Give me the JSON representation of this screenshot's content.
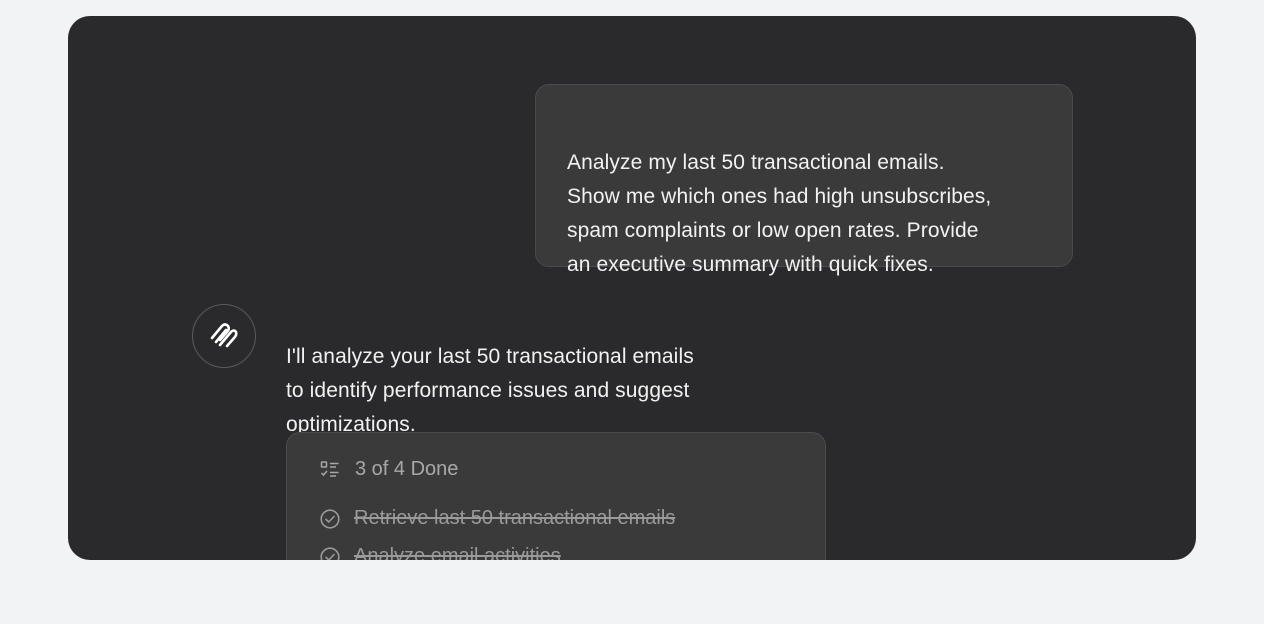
{
  "conversation": {
    "user_message": "Analyze my last 50 transactional emails.\nShow me which ones had high unsubscribes,\nspam complaints or low open rates. Provide\nan executive summary with quick fixes.",
    "assistant_avatar_icon": "assistant-logo-icon",
    "assistant_message": "I'll analyze your last 50 transactional emails\nto identify performance issues and suggest\noptimizations."
  },
  "task_list": {
    "header_icon": "checklist-icon",
    "progress_label": "3 of 4 Done",
    "items": [
      {
        "label": "Retrieve last 50 transactional emails",
        "status": "done",
        "icon": "check-circle-icon"
      },
      {
        "label": "Analyze email activities",
        "status": "done",
        "icon": "check-circle-icon"
      }
    ]
  },
  "colors": {
    "page_background": "#f2f3f5",
    "panel_background": "#2a2a2c",
    "bubble_background": "#3a3a3a",
    "text_primary": "#f2f2f2",
    "text_muted": "#9a9a9a"
  }
}
